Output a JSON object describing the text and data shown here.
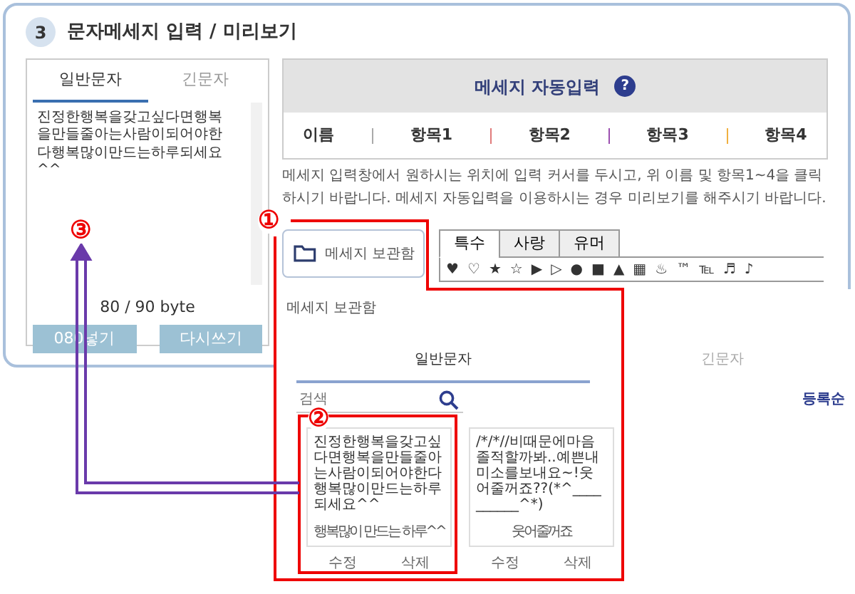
{
  "section": {
    "number": "3",
    "title": "문자메세지 입력 / 미리보기"
  },
  "editor": {
    "tabs": [
      {
        "label": "일반문자",
        "selected": true
      },
      {
        "label": "긴문자",
        "selected": false
      }
    ],
    "message": "진정한행복을갖고싶다면행복을만들줄아는사람이되어야한다행복많이만드는하루되세요^^",
    "counter": "80 / 90 byte",
    "buttons": [
      "080넣기",
      "다시쓰기"
    ]
  },
  "auto_input": {
    "title": "메세지 자동입력",
    "help": "?",
    "items": [
      {
        "label": "이름"
      },
      {
        "label": "항목1"
      },
      {
        "label": "항목2"
      },
      {
        "label": "항목3"
      },
      {
        "label": "항목4"
      }
    ],
    "separators": [
      {
        "color": "#aaaaaa"
      },
      {
        "color": "#e07b7b"
      },
      {
        "color": "#9b4fb0"
      },
      {
        "color": "#f0b040"
      }
    ],
    "description": "메세지 입력창에서 원하시는 위치에 입력 커서를 두시고, 위 이름 및 항목1~4을 클릭하시기 바랍니다. 메세지 자동입력을 이용하시는 경우 미리보기를 해주시기 바랍니다."
  },
  "storage_button": "메세지 보관함",
  "symbols": {
    "tabs": [
      {
        "label": "특수",
        "selected": true
      },
      {
        "label": "사랑",
        "selected": false
      },
      {
        "label": "유머",
        "selected": false
      }
    ],
    "items": [
      "♥",
      "♡",
      "★",
      "☆",
      "▶",
      "▷",
      "●",
      "■",
      "▲",
      "▦",
      "♨",
      "™",
      "℡",
      "♬",
      "♪"
    ]
  },
  "storage": {
    "label": "메세지 보관함",
    "tabs": [
      {
        "label": "일반문자",
        "selected": true
      },
      {
        "label": "긴문자",
        "selected": false
      }
    ],
    "search": {
      "placeholder": "검색"
    },
    "sort": "등록순",
    "cards": [
      {
        "text": "진정한행복을갖고싶다면행복을만들줄아는사람이되어야한다행복많이만드는하루되세요^^",
        "title": "행복많이 만드는 하루^^",
        "actions": [
          "수정",
          "삭제"
        ]
      },
      {
        "text": "/*/*//비때문에마음졸적할까봐..예쁜내미소를보내요~!웃어줄꺼죠??(*^__________^*)",
        "title": "웃어줄꺼죠",
        "actions": [
          "수정",
          "삭제"
        ]
      }
    ]
  },
  "callouts": [
    "①",
    "②",
    "③"
  ]
}
